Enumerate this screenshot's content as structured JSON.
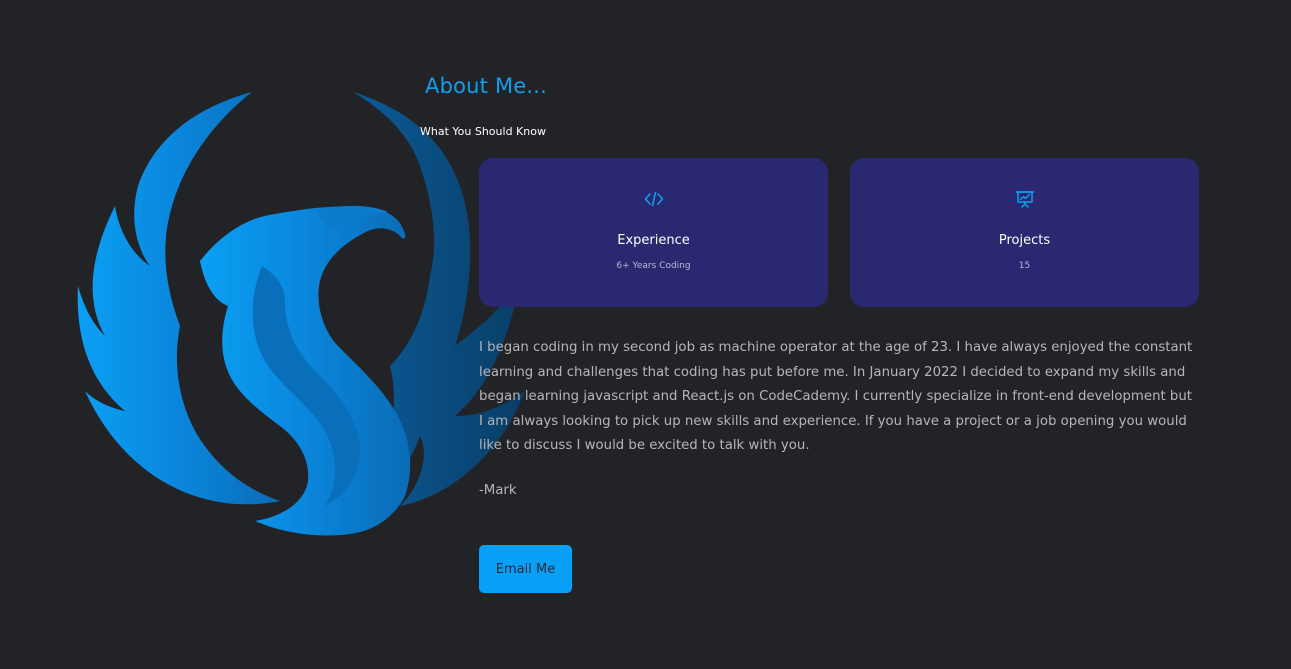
{
  "about": {
    "title": "About Me...",
    "subtitle": "What You Should Know"
  },
  "cards": [
    {
      "icon": "code-icon",
      "title": "Experience",
      "value": "6+ Years Coding"
    },
    {
      "icon": "presentation-icon",
      "title": "Projects",
      "value": "15"
    }
  ],
  "bio": {
    "text": "I began coding in my second job as machine operator at the age of 23. I have always enjoyed the constant learning and challenges that coding has put before me. In January 2022 I decided to expand my skills and began learning javascript and React.js on CodeCademy. I currently specialize in front-end development but I am always looking to pick up new skills and experience. If you have a project or a job opening you would like to discuss I would be excited to talk with you.",
    "signature": "-Mark"
  },
  "email_button": {
    "label": "Email Me"
  },
  "logo": {
    "icon": "phoenix-logo-icon"
  },
  "colors": {
    "background": "#222327",
    "accent": "#0ea0f0",
    "card": "#2a2870",
    "button": "#08a0f7"
  }
}
